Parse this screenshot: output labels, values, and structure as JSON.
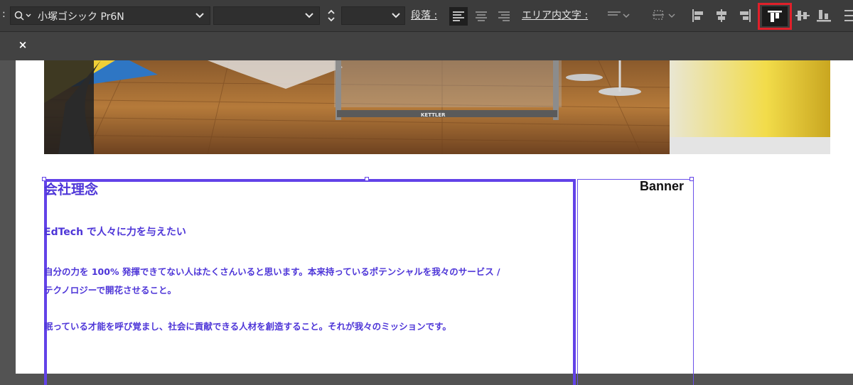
{
  "toolbar": {
    "colon": ":",
    "font_name": "小塚ゴシック Pr6N",
    "paragraph_label": "段落 :",
    "area_text_label": "エリア内文字 :"
  },
  "tab": {
    "close_label": "×"
  },
  "photo": {
    "brand_text": "KETTLER"
  },
  "content": {
    "heading": "会社理念",
    "subheading": "EdTech で人々に力を与えたい",
    "paragraph1": "自分の力を 100% 発揮できてない人はたくさんいると思います。本来持っているポテンシャルを我々のサービス /",
    "paragraph1_line2": "テクノロジーで開花させること。",
    "paragraph2": "眠っている才能を呼び覚まし、社会に貢献できる人材を創造すること。それが我々のミッションです。",
    "banner_label": "Banner"
  },
  "colors": {
    "selection": "#6242e8",
    "text": "#4e36d8",
    "highlight": "#e0202a",
    "toolbar": "#3c3c3c"
  }
}
